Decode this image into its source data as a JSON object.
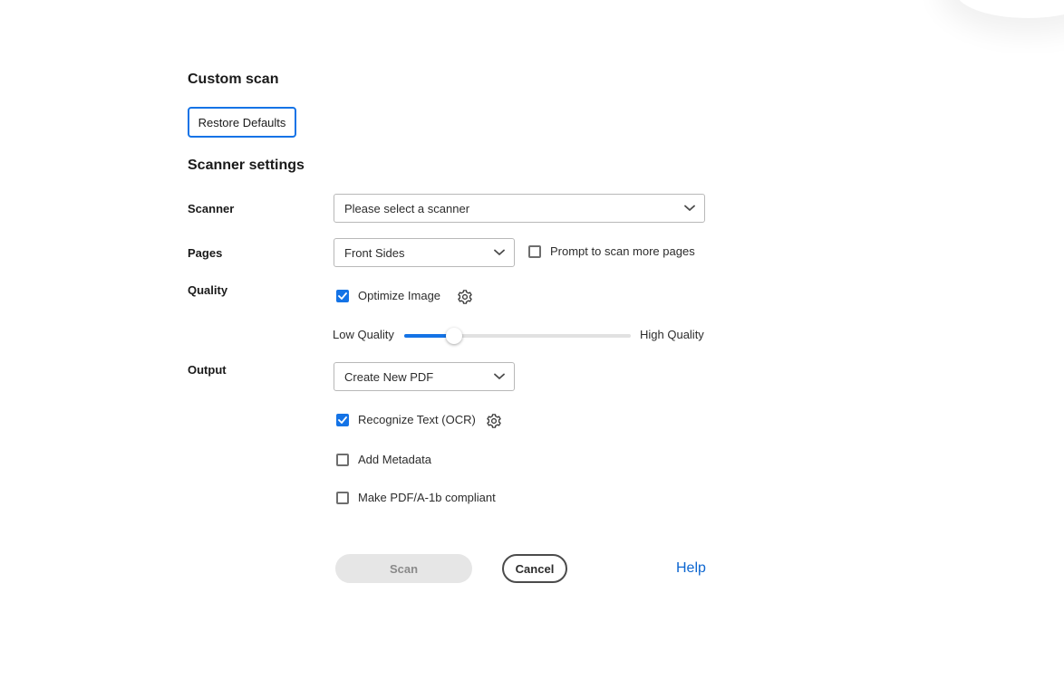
{
  "titles": {
    "custom_scan": "Custom scan",
    "scanner_settings": "Scanner settings"
  },
  "restore_defaults_label": "Restore Defaults",
  "scanner": {
    "label": "Scanner",
    "selected": "Please select a scanner"
  },
  "pages": {
    "label": "Pages",
    "selected": "Front Sides",
    "prompt_more_label": "Prompt to scan more pages",
    "prompt_more_checked": false
  },
  "quality": {
    "label": "Quality",
    "optimize_label": "Optimize Image",
    "optimize_checked": true,
    "low_label": "Low Quality",
    "high_label": "High Quality",
    "slider_value": 0.22
  },
  "output": {
    "label": "Output",
    "selected": "Create New PDF",
    "ocr_label": "Recognize Text (OCR)",
    "ocr_checked": true,
    "metadata_label": "Add Metadata",
    "metadata_checked": false,
    "pdfa_label": "Make PDF/A-1b compliant",
    "pdfa_checked": false
  },
  "actions": {
    "scan_label": "Scan",
    "cancel_label": "Cancel",
    "help_label": "Help"
  },
  "colors": {
    "accent": "#1473e6",
    "link": "#0d66d0",
    "disabled_bg": "#e6e6e6"
  },
  "icons": {
    "dropdown": "chevron-down-icon",
    "settings": "gear-icon",
    "check": "checkmark-icon"
  }
}
